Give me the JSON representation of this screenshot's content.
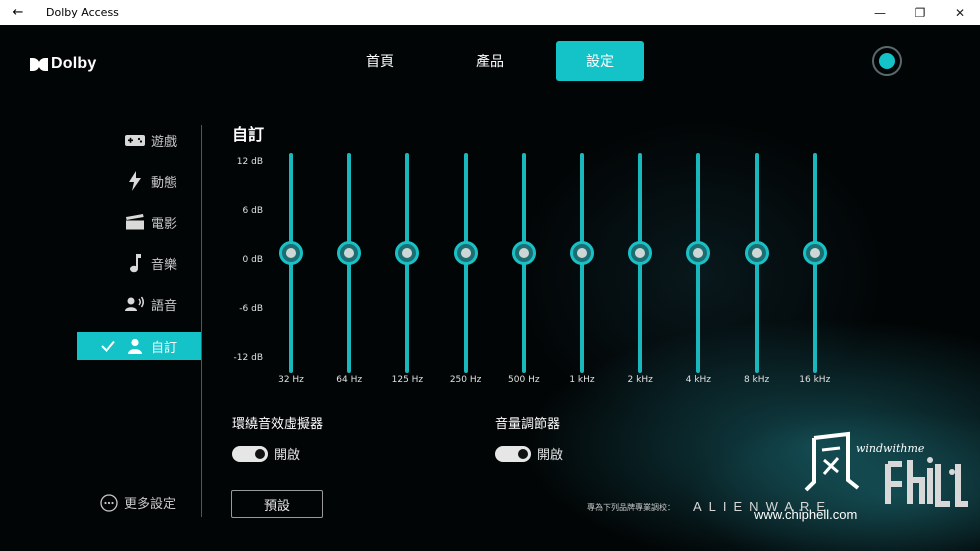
{
  "window": {
    "title": "Dolby Access",
    "back_glyph": "←",
    "minimize_glyph": "—",
    "restore_glyph": "❐",
    "close_glyph": "✕"
  },
  "logo": {
    "text": "Dolby",
    "icon": "dolby-double-d-icon"
  },
  "nav": {
    "tabs": [
      {
        "label": "首頁",
        "active": false
      },
      {
        "label": "產品",
        "active": false
      },
      {
        "label": "設定",
        "active": true
      }
    ],
    "accent": "#14c3c8"
  },
  "profile": {
    "icon": "profile-status-icon"
  },
  "sidebar": {
    "items": [
      {
        "label": "遊戲",
        "icon": "gamepad-icon",
        "active": false
      },
      {
        "label": "動態",
        "icon": "lightning-icon",
        "active": false
      },
      {
        "label": "電影",
        "icon": "clapperboard-icon",
        "active": false
      },
      {
        "label": "音樂",
        "icon": "music-note-icon",
        "active": false
      },
      {
        "label": "語音",
        "icon": "voice-icon",
        "active": false
      },
      {
        "label": "自訂",
        "icon": "person-icon",
        "active": true
      }
    ],
    "more_label": "更多設定"
  },
  "custom": {
    "title": "自訂",
    "db_labels": [
      "12 dB",
      "6 dB",
      "0 dB",
      "-6 dB",
      "-12 dB"
    ],
    "bands": [
      {
        "freq": "32 Hz",
        "gain_db": 0
      },
      {
        "freq": "64 Hz",
        "gain_db": 0
      },
      {
        "freq": "125 Hz",
        "gain_db": 0
      },
      {
        "freq": "250 Hz",
        "gain_db": 0
      },
      {
        "freq": "500 Hz",
        "gain_db": 0
      },
      {
        "freq": "1 kHz",
        "gain_db": 0
      },
      {
        "freq": "2 kHz",
        "gain_db": 0
      },
      {
        "freq": "4 kHz",
        "gain_db": 0
      },
      {
        "freq": "8 kHz",
        "gain_db": 0
      },
      {
        "freq": "16 kHz",
        "gain_db": 0
      }
    ],
    "surround": {
      "label": "環繞音效虛擬器",
      "state": "開啟",
      "on": true
    },
    "volume_leveler": {
      "label": "音量調節器",
      "state": "開啟",
      "on": true
    },
    "preset_button": "預設"
  },
  "footer": {
    "tuned_text": "專為下列品牌專業調校：",
    "brand": "ALIENWARE"
  },
  "watermark": {
    "url": "www.chiphell.com",
    "script": "windwithme"
  }
}
